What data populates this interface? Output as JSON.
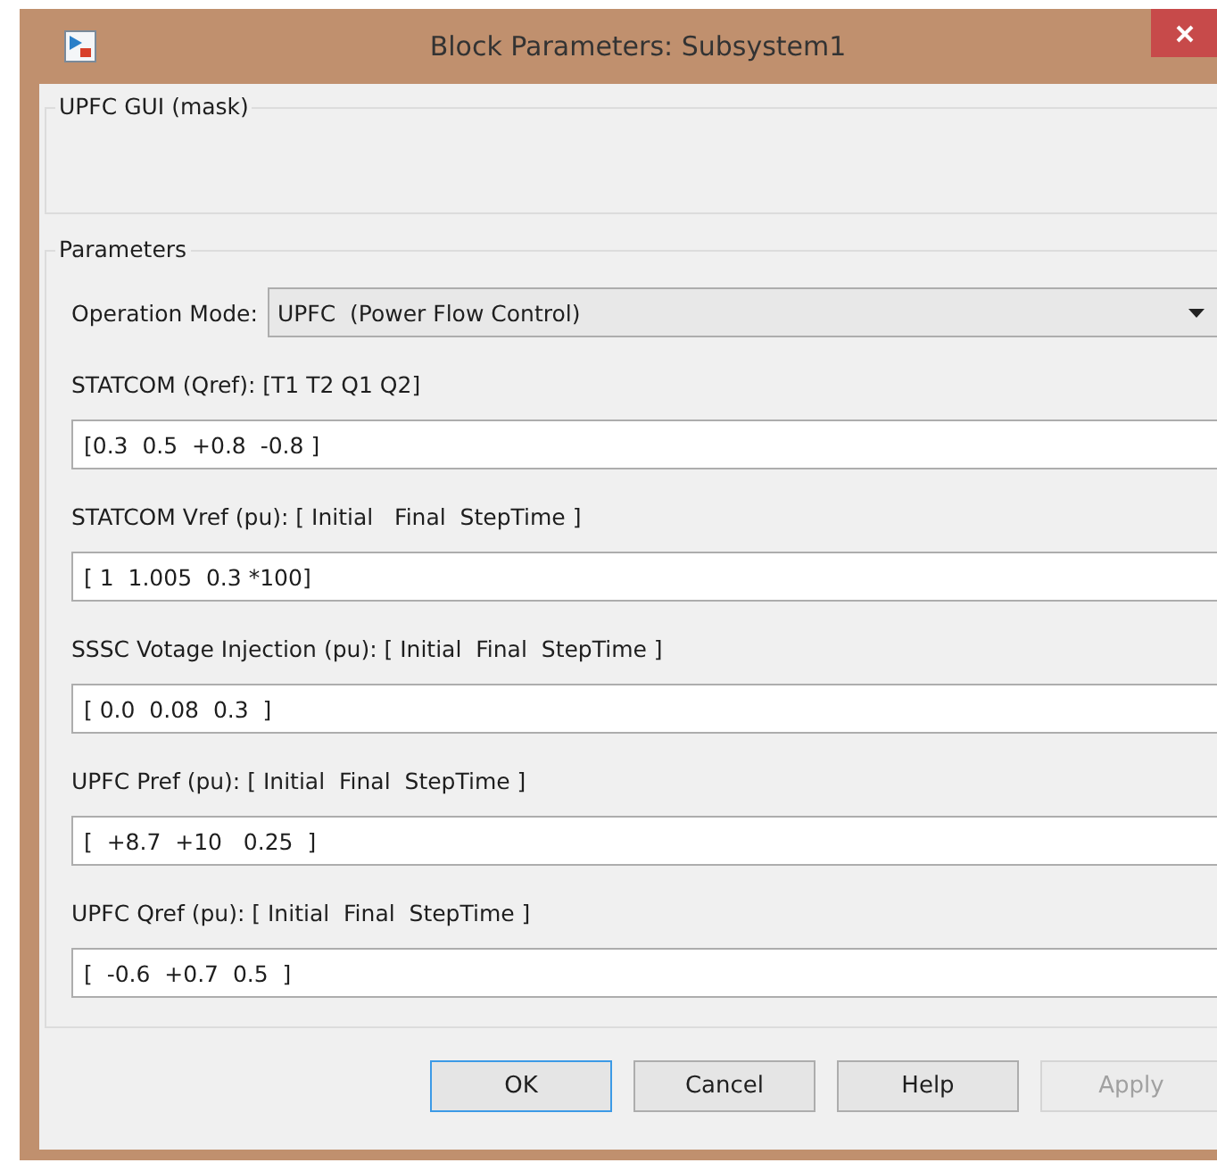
{
  "window": {
    "title": "Block Parameters: Subsystem1"
  },
  "mask_group": {
    "title": "UPFC GUI (mask)"
  },
  "parameters_group": {
    "title": "Parameters",
    "operation_mode": {
      "label": "Operation Mode:",
      "value": "UPFC  (Power Flow Control)"
    },
    "fields": [
      {
        "label": "STATCOM (Qref): [T1 T2 Q1 Q2]",
        "value": "[0.3  0.5  +0.8  -0.8 ]"
      },
      {
        "label": "STATCOM Vref (pu): [ Initial   Final  StepTime ]",
        "value": "[ 1  1.005  0.3 *100]"
      },
      {
        "label": "SSSC Votage Injection (pu): [ Initial  Final  StepTime ]",
        "value": "[ 0.0  0.08  0.3  ]"
      },
      {
        "label": "UPFC Pref (pu): [ Initial  Final  StepTime ]",
        "value": "[  +8.7  +10   0.25  ]"
      },
      {
        "label": "UPFC Qref (pu): [ Initial  Final  StepTime ]",
        "value": "[  -0.6  +0.7  0.5  ]"
      }
    ]
  },
  "buttons": [
    {
      "label": "OK",
      "disabled": false,
      "default": true
    },
    {
      "label": "Cancel",
      "disabled": false,
      "default": false
    },
    {
      "label": "Help",
      "disabled": false,
      "default": false
    },
    {
      "label": "Apply",
      "disabled": true,
      "default": false
    }
  ]
}
